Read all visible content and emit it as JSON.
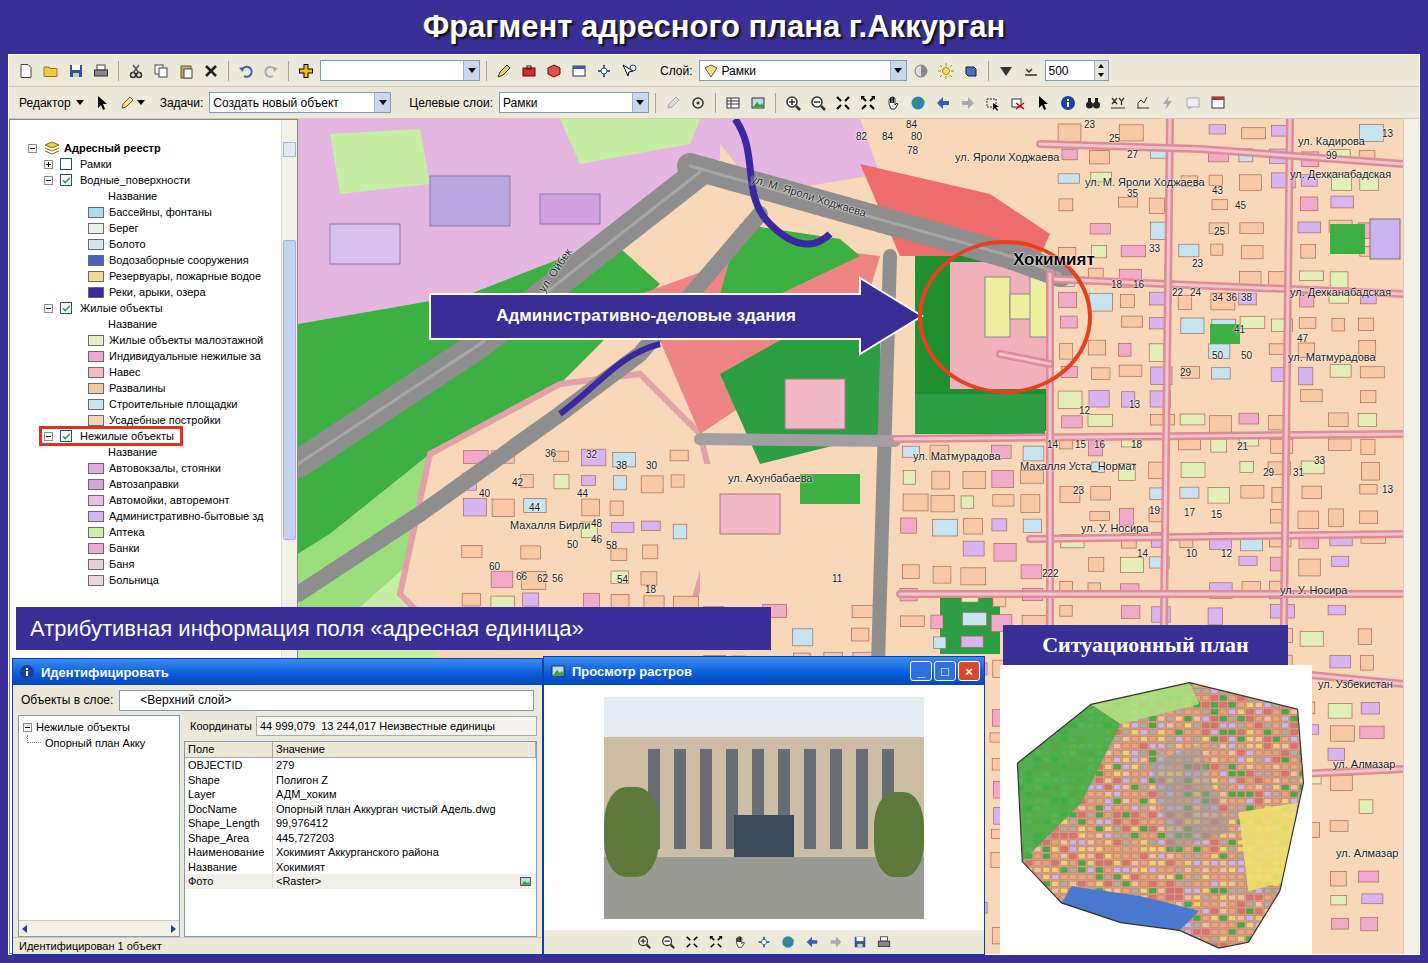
{
  "title": "Фрагмент адресного плана г.Аккурган",
  "toolbar": {
    "layer_label": "Слой:",
    "layer_value": "Рамки",
    "scale": "500",
    "editor": "Редактор",
    "task_label": "Задачи:",
    "task_value": "Создать новый объект",
    "target_label": "Целевые слои:",
    "target_value": "Рамки"
  },
  "toc": {
    "items": [
      {
        "kind": "root",
        "label": "Адресный реестр",
        "expanded": true
      },
      {
        "kind": "layer",
        "label": "Рамки",
        "checked": false,
        "expanded": false,
        "highlighted": false
      },
      {
        "kind": "layer",
        "label": "Водные_поверхности",
        "checked": true,
        "expanded": true,
        "highlighted": false
      },
      {
        "kind": "heading",
        "label": "Название"
      },
      {
        "kind": "legend",
        "label": "Бассейны, фонтаны",
        "color": "#a9dcef"
      },
      {
        "kind": "legend",
        "label": "Берег",
        "color": "#e4f6e4"
      },
      {
        "kind": "legend",
        "label": "Болото",
        "color": "#cfe6f6"
      },
      {
        "kind": "legend",
        "label": "Водозаборные сооружения",
        "color": "#4a62c4"
      },
      {
        "kind": "legend",
        "label": "Резервуары, пожарные водое",
        "color": "#f3d98c"
      },
      {
        "kind": "legend",
        "label": "Реки, арыки, озера",
        "color": "#3b2a9e"
      },
      {
        "kind": "layer",
        "label": "Жилые объекты",
        "checked": true,
        "expanded": true,
        "highlighted": false
      },
      {
        "kind": "heading",
        "label": "Название"
      },
      {
        "kind": "legend",
        "label": "Жилые объекты малоэтажной",
        "color": "#e3f1c4"
      },
      {
        "kind": "legend",
        "label": "Индивидуальные нежилые за",
        "color": "#f2a9cd"
      },
      {
        "kind": "legend",
        "label": "Навес",
        "color": "#f7b9bd"
      },
      {
        "kind": "legend",
        "label": "Развалины",
        "color": "#f4c99c"
      },
      {
        "kind": "legend",
        "label": "Строительные площадки",
        "color": "#c6e5f1"
      },
      {
        "kind": "legend",
        "label": "Усадебные постройки",
        "color": "#f8d4b4"
      },
      {
        "kind": "layer",
        "label": "Нежилые объекты",
        "checked": true,
        "expanded": true,
        "highlighted": true
      },
      {
        "kind": "heading",
        "label": "Название"
      },
      {
        "kind": "legend",
        "label": "Автовокзалы, стоянки",
        "color": "#e2a9e2"
      },
      {
        "kind": "legend",
        "label": "Автозаправки",
        "color": "#d4a3da"
      },
      {
        "kind": "legend",
        "label": "Автомойки, авторемонт",
        "color": "#ebbbea"
      },
      {
        "kind": "legend",
        "label": "Административно-бытовые зд",
        "color": "#d9b4f2"
      },
      {
        "kind": "legend",
        "label": "Аптека",
        "color": "#c9f0a3"
      },
      {
        "kind": "legend",
        "label": "Банки",
        "color": "#f1aad2"
      },
      {
        "kind": "legend",
        "label": "Баня",
        "color": "#e9c9da"
      },
      {
        "kind": "legend",
        "label": "Больница",
        "color": "#f3d3e3"
      }
    ]
  },
  "map": {
    "landmark": "Хокимият",
    "callout": "Административно-деловые здания",
    "streets": [
      "ул. М. Яроли Ходжаева",
      "ул. Ойбек",
      "ул. Яроли Ходжаева",
      "ул. М. Яроли Ходжаева",
      "ул. Кадирова",
      "ул. Дехканабадская",
      "ул. Дехканабадская",
      "ул. Матмурадова",
      "ул. Матмурадова",
      "ул. Ахунбабаева",
      "Махалля Уста_Нормат",
      "Махалля Бирли",
      "ул. У. Носира",
      "ул. У. Носира",
      "ул. Узбекистан",
      "ул. Алмазар",
      "ул. Алмазар"
    ],
    "numbers": [
      "84",
      "82",
      "84",
      "80",
      "78",
      "23",
      "25",
      "27",
      "13",
      "99",
      "43",
      "45",
      "35",
      "25",
      "33",
      "23",
      "18",
      "16",
      "22",
      "24",
      "34",
      "36",
      "38",
      "41",
      "47",
      "50",
      "50",
      "29",
      "13",
      "12",
      "14",
      "15",
      "16",
      "18",
      "21",
      "29",
      "31",
      "33",
      "23",
      "19",
      "17",
      "15",
      "14",
      "10",
      "12",
      "222",
      "36",
      "32",
      "40",
      "42",
      "44",
      "44",
      "38",
      "30",
      "48",
      "46",
      "50",
      "56",
      "58",
      "54",
      "60",
      "62",
      "66",
      "18",
      "13",
      "11"
    ]
  },
  "attr_banner": "Атрибутивная информация поля «адресная единица»",
  "identify": {
    "title": "Идентифицировать",
    "layer_label": "Объекты в слое:",
    "layer_value": "<Верхний слой>",
    "tree": [
      {
        "label": "Нежилые объекты",
        "expanded": true
      },
      {
        "label": "Опорный план Акку"
      }
    ],
    "coords_label": "Координаты",
    "coords_value": "44 999,079  13 244,017 Неизвестные единицы",
    "columns": [
      "Поле",
      "Значение"
    ],
    "rows": [
      [
        "OBJECTID",
        "279"
      ],
      [
        "Shape",
        "Полигон Z"
      ],
      [
        "Layer",
        "АДМ_хоким"
      ],
      [
        "DocName",
        "Опорный план Аккурган чистый Адель.dwg"
      ],
      [
        "Shape_Length",
        "99,976412"
      ],
      [
        "Shape_Area",
        "445,727203"
      ],
      [
        "Наименование",
        "Хокимият Аккурганского района"
      ],
      [
        "Название",
        "Хокимият"
      ],
      [
        "Фото",
        "<Raster>"
      ]
    ],
    "status": "Идентифицирован 1 объект"
  },
  "raster": {
    "title": "Просмотр растров",
    "buttons": [
      "_",
      "□",
      "×"
    ]
  },
  "plan": {
    "title": "Ситуационный план"
  }
}
